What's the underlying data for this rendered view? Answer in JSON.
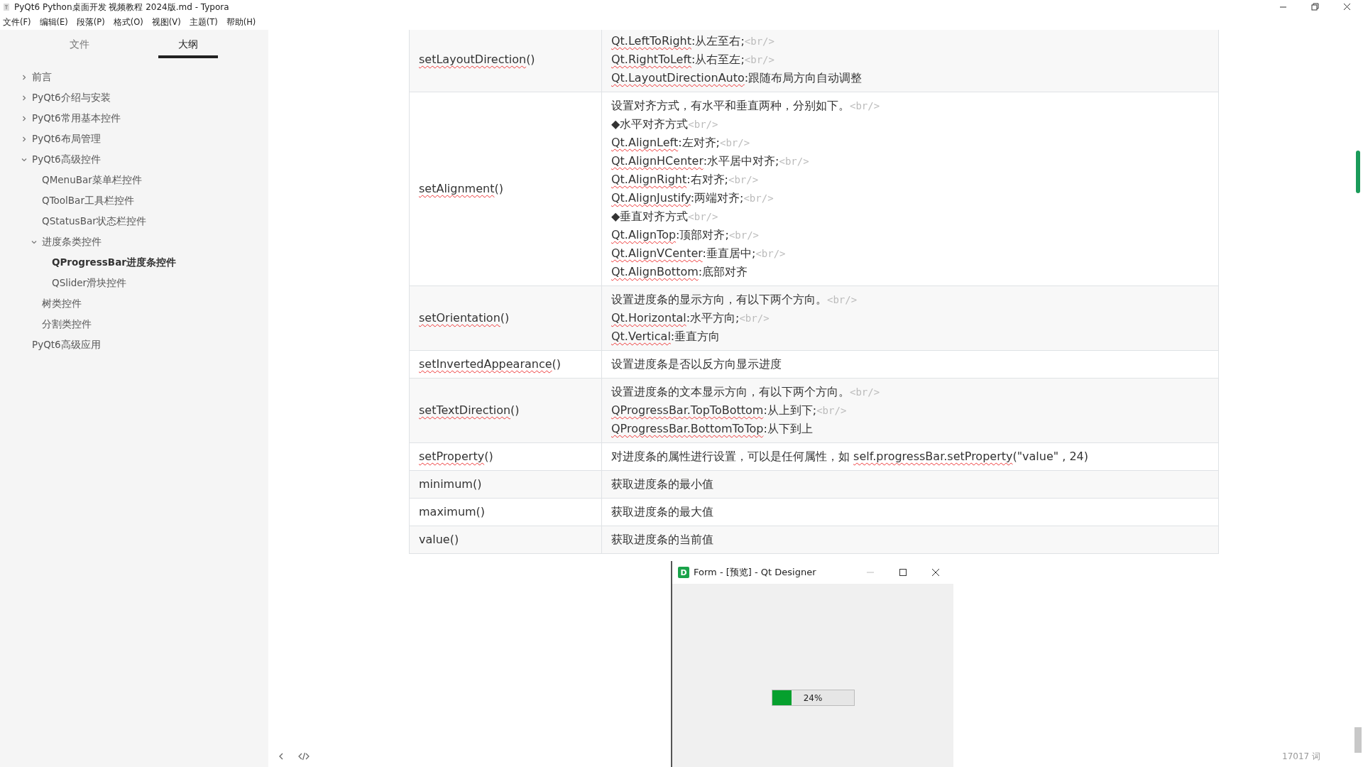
{
  "window": {
    "title": "PyQt6 Python桌面开发 视频教程 2024版.md - Typora"
  },
  "menu": [
    "文件(F)",
    "编辑(E)",
    "段落(P)",
    "格式(O)",
    "视图(V)",
    "主题(T)",
    "帮助(H)"
  ],
  "sidebar": {
    "tabs": [
      {
        "label": "文件",
        "selected": false
      },
      {
        "label": "大纲",
        "selected": true
      }
    ],
    "outline": [
      {
        "label": "前言",
        "kind": "branch",
        "expanded": false,
        "selected": false
      },
      {
        "label": "PyQt6介绍与安装",
        "kind": "branch",
        "expanded": false,
        "selected": false
      },
      {
        "label": "PyQt6常用基本控件",
        "kind": "branch",
        "expanded": false,
        "selected": false
      },
      {
        "label": "PyQt6布局管理",
        "kind": "branch",
        "expanded": false,
        "selected": false
      },
      {
        "label": "PyQt6高级控件",
        "kind": "branch",
        "expanded": true,
        "selected": false,
        "children": [
          {
            "label": "QMenuBar菜单栏控件",
            "kind": "leaf",
            "selected": false
          },
          {
            "label": "QToolBar工具栏控件",
            "kind": "leaf",
            "selected": false
          },
          {
            "label": "QStatusBar状态栏控件",
            "kind": "leaf",
            "selected": false
          },
          {
            "label": "进度条类控件",
            "kind": "branch",
            "expanded": true,
            "selected": false,
            "children": [
              {
                "label": "QProgressBar进度条控件",
                "kind": "leaf",
                "selected": true
              },
              {
                "label": "QSlider滑块控件",
                "kind": "leaf",
                "selected": false
              }
            ]
          },
          {
            "label": "树类控件",
            "kind": "leaf",
            "selected": false
          },
          {
            "label": "分割类控件",
            "kind": "leaf",
            "selected": false
          }
        ]
      },
      {
        "label": "PyQt6高级应用",
        "kind": "leaf",
        "selected": false
      }
    ]
  },
  "table": {
    "rows": [
      {
        "method": [
          {
            "kind": "spell",
            "text": "setLayoutDirection"
          },
          {
            "kind": "plain",
            "text": "()"
          }
        ],
        "description": [
          [
            {
              "kind": "spell",
              "text": "Qt.LeftToRight"
            },
            {
              "kind": "plain",
              "text": ":从左至右;"
            },
            {
              "kind": "tag",
              "text": "<br/>"
            }
          ],
          [
            {
              "kind": "spell",
              "text": "Qt.RightToLeft"
            },
            {
              "kind": "plain",
              "text": ":从右至左;"
            },
            {
              "kind": "tag",
              "text": "<br/>"
            }
          ],
          [
            {
              "kind": "spell",
              "text": "Qt.LayoutDirectionAuto"
            },
            {
              "kind": "plain",
              "text": ":跟随布局方向自动调整"
            }
          ]
        ]
      },
      {
        "method": [
          {
            "kind": "spell",
            "text": "setAlignment"
          },
          {
            "kind": "plain",
            "text": "()"
          }
        ],
        "description": [
          [
            {
              "kind": "plain",
              "text": "设置对齐方式，有水平和垂直两种，分别如下。"
            },
            {
              "kind": "tag",
              "text": "<br/>"
            }
          ],
          [
            {
              "kind": "plain",
              "text": "◆水平对齐方式"
            },
            {
              "kind": "tag",
              "text": "<br/>"
            }
          ],
          [
            {
              "kind": "spell",
              "text": "Qt.AlignLeft"
            },
            {
              "kind": "plain",
              "text": ":左对齐;"
            },
            {
              "kind": "tag",
              "text": "<br/>"
            }
          ],
          [
            {
              "kind": "spell",
              "text": "Qt.AlignHCenter"
            },
            {
              "kind": "plain",
              "text": ":水平居中对齐;"
            },
            {
              "kind": "tag",
              "text": "<br/>"
            }
          ],
          [
            {
              "kind": "spell",
              "text": "Qt.AlignRight"
            },
            {
              "kind": "plain",
              "text": ":右对齐;"
            },
            {
              "kind": "tag",
              "text": "<br/>"
            }
          ],
          [
            {
              "kind": "spell",
              "text": "Qt.AlignJustify"
            },
            {
              "kind": "plain",
              "text": ":两端对齐;"
            },
            {
              "kind": "tag",
              "text": "<br/>"
            }
          ],
          [
            {
              "kind": "plain",
              "text": "◆垂直对齐方式"
            },
            {
              "kind": "tag",
              "text": "<br/>"
            }
          ],
          [
            {
              "kind": "spell",
              "text": "Qt.AlignTop"
            },
            {
              "kind": "plain",
              "text": ":顶部对齐;"
            },
            {
              "kind": "tag",
              "text": "<br/>"
            }
          ],
          [
            {
              "kind": "spell",
              "text": "Qt.AlignVCenter"
            },
            {
              "kind": "plain",
              "text": ":垂直居中;"
            },
            {
              "kind": "tag",
              "text": "<br/>"
            }
          ],
          [
            {
              "kind": "spell",
              "text": "Qt.AlignBottom"
            },
            {
              "kind": "plain",
              "text": ":底部对齐"
            }
          ]
        ]
      },
      {
        "method": [
          {
            "kind": "spell",
            "text": "setOrientation"
          },
          {
            "kind": "plain",
            "text": "()"
          }
        ],
        "description": [
          [
            {
              "kind": "plain",
              "text": "设置进度条的显示方向，有以下两个方向。"
            },
            {
              "kind": "tag",
              "text": "<br/>"
            }
          ],
          [
            {
              "kind": "spell",
              "text": "Qt.Horizontal"
            },
            {
              "kind": "plain",
              "text": ":水平方向;"
            },
            {
              "kind": "tag",
              "text": "<br/>"
            }
          ],
          [
            {
              "kind": "spell",
              "text": "Qt.Vertical"
            },
            {
              "kind": "plain",
              "text": ":垂直方向"
            }
          ]
        ]
      },
      {
        "method": [
          {
            "kind": "spell",
            "text": "setInvertedAppearance"
          },
          {
            "kind": "plain",
            "text": "()"
          }
        ],
        "description": [
          [
            {
              "kind": "plain",
              "text": "设置进度条是否以反方向显示进度"
            }
          ]
        ]
      },
      {
        "method": [
          {
            "kind": "spell",
            "text": "setTextDirection"
          },
          {
            "kind": "plain",
            "text": "()"
          }
        ],
        "description": [
          [
            {
              "kind": "plain",
              "text": "设置进度条的文本显示方向，有以下两个方向。"
            },
            {
              "kind": "tag",
              "text": "<br/>"
            }
          ],
          [
            {
              "kind": "spell",
              "text": "QProgressBar.TopToBottom"
            },
            {
              "kind": "plain",
              "text": ":从上到下;"
            },
            {
              "kind": "tag",
              "text": "<br/>"
            }
          ],
          [
            {
              "kind": "spell",
              "text": "QProgressBar.BottomToTop"
            },
            {
              "kind": "plain",
              "text": ":从下到上"
            }
          ]
        ]
      },
      {
        "method": [
          {
            "kind": "spell",
            "text": "setProperty"
          },
          {
            "kind": "plain",
            "text": "()"
          }
        ],
        "description": [
          [
            {
              "kind": "plain",
              "text": "对进度条的属性进行设置，可以是任何属性，如 "
            },
            {
              "kind": "spell",
              "text": "self.progressBar.setProperty"
            },
            {
              "kind": "plain",
              "text": "(\"value\" , 24)"
            }
          ]
        ]
      },
      {
        "method": [
          {
            "kind": "plain",
            "text": "minimum()"
          }
        ],
        "description": [
          [
            {
              "kind": "plain",
              "text": "获取进度条的最小值"
            }
          ]
        ]
      },
      {
        "method": [
          {
            "kind": "plain",
            "text": "maximum()"
          }
        ],
        "description": [
          [
            {
              "kind": "plain",
              "text": "获取进度条的最大值"
            }
          ]
        ]
      },
      {
        "method": [
          {
            "kind": "plain",
            "text": "value()"
          }
        ],
        "description": [
          [
            {
              "kind": "plain",
              "text": "获取进度条的当前值"
            }
          ]
        ]
      }
    ]
  },
  "status_bar": {
    "word_count": "17017 词"
  },
  "preview_window": {
    "app_icon_letter": "D",
    "title": "Form - [预览] - Qt Designer",
    "progress": {
      "level": 0.24,
      "reading": "24%"
    }
  }
}
